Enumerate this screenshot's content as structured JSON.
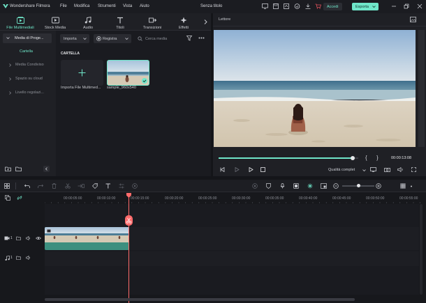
{
  "app": {
    "title": "Wondershare Filmora",
    "project": "Senza titolo",
    "accent": "#6fe6c9",
    "clip_color": "#3c8f7f"
  },
  "menu": [
    "File",
    "Modifica",
    "Strumenti",
    "Vista",
    "Aiuto"
  ],
  "header": {
    "login_label": "Accedi",
    "export_label": "Esporta"
  },
  "tabs": [
    {
      "label": "File Multimediali",
      "icon": "media-icon"
    },
    {
      "label": "Stock Media",
      "icon": "stock-icon"
    },
    {
      "label": "Audio",
      "icon": "music-note-icon"
    },
    {
      "label": "Titoli",
      "icon": "text-icon"
    },
    {
      "label": "Transizioni",
      "icon": "transition-icon"
    },
    {
      "label": "Effetti",
      "icon": "effects-icon"
    }
  ],
  "sidebar": {
    "project_media": "Media di Proge...",
    "folder": "Cartella",
    "items": [
      "Media Condiviso",
      "Spazio su cloud",
      "Livello regolazi..."
    ]
  },
  "browser": {
    "import_label": "Importa",
    "record_label": "Registra",
    "search_placeholder": "Cerca media",
    "section": "CARTELLA",
    "import_tile_label": "Importa File Multimed...",
    "clip_name": "sample_960x540"
  },
  "player": {
    "title": "Lettore",
    "time": "00:00:13:08",
    "quality": "Qualità complet",
    "progress": 0.96
  },
  "timeline": {
    "ruler": [
      "00:00:05:00",
      "00:00:10:00",
      "00:00:15:00",
      "00:00:20:00",
      "00:00:25:00",
      "00:00:30:00",
      "00:00:35:00",
      "00:00:40:00",
      "00:00:45:00",
      "00:00:50:00",
      "00:00:55:00"
    ],
    "video_track_no": "1",
    "audio_track_no": "1",
    "zoom_level": 0.5
  }
}
